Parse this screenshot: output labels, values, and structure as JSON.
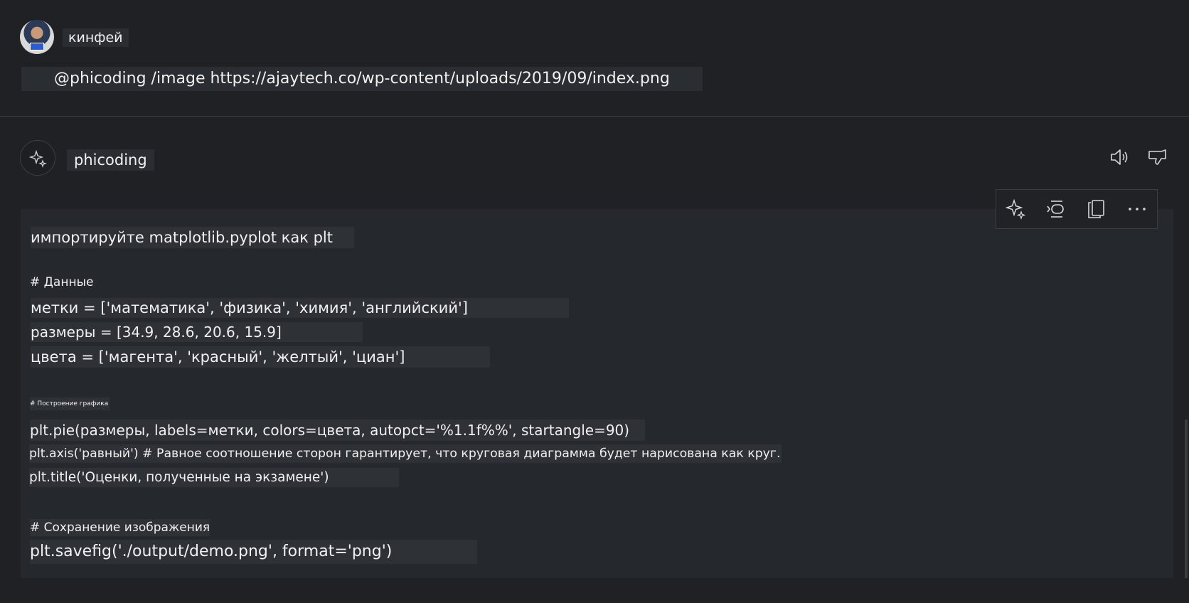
{
  "user": {
    "name": "кинфей"
  },
  "prompt": {
    "text": "@phicoding /image https://ajaytech.co/wp-content/uploads/2019/09/index.png"
  },
  "bot": {
    "name": "phicoding"
  },
  "header_actions": {
    "speak_icon": "speaker-icon",
    "dislike_icon": "thumbs-down-icon"
  },
  "toolbar": {
    "icons": [
      "sparkle-icon",
      "insert-code-icon",
      "copy-icon",
      "more-icon"
    ]
  },
  "code": {
    "line1": "импортируйте matplotlib.pyplot как plt",
    "line2": "# Данные",
    "line3": "метки = ['математика', 'физика', 'химия', 'английский']",
    "line4": "размеры = [34.9, 28.6, 20.6, 15.9]",
    "line5": "цвета = ['магента', 'красный', 'желтый', 'циан']",
    "line6": "# Построение графика",
    "line7": "plt.pie(размеры, labels=метки, colors=цвета, autopct='%1.1f%%', startangle=90)",
    "line8": "plt.axis('равный') # Равное соотношение сторон гарантирует, что круговая диаграмма будет нарисована как круг.",
    "line9": "plt.title('Оценки, полученные на экзамене')",
    "line10": "# Сохранение изображения",
    "line11": "plt.savefig('./output/demo.png', format='png')"
  }
}
